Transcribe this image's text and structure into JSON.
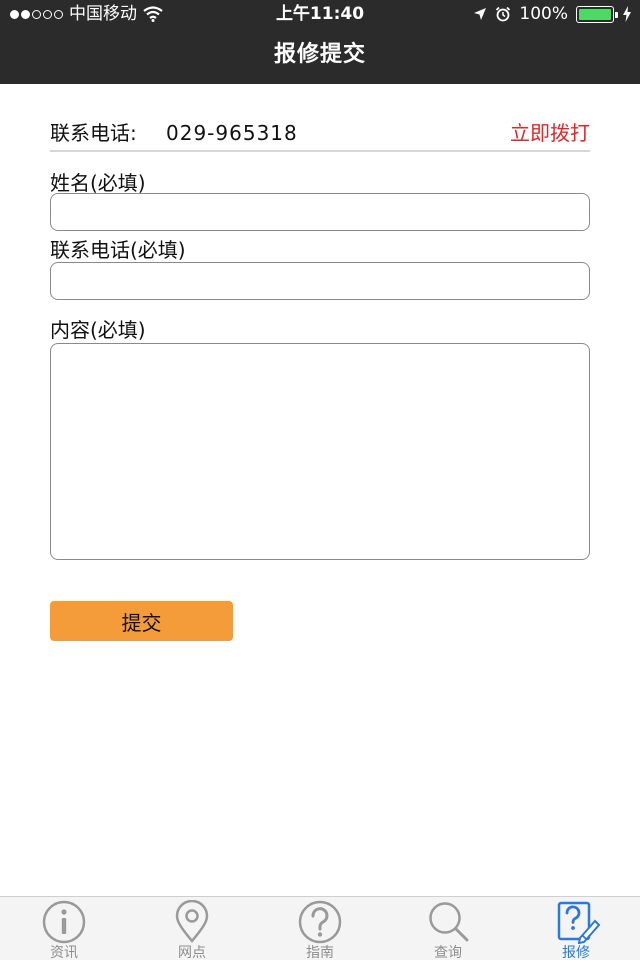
{
  "status_bar": {
    "carrier": "中国移动",
    "time": "上午11:40",
    "battery": "100%"
  },
  "nav": {
    "title": "报修提交"
  },
  "contact": {
    "label": "联系电话:",
    "number": "029-965318",
    "call_label": "立即拨打"
  },
  "form": {
    "name_label": "姓名(必填)",
    "name_value": "",
    "phone_label": "联系电话(必填)",
    "phone_value": "",
    "content_label": "内容(必填)",
    "content_value": "",
    "submit_label": "提交"
  },
  "tabs": [
    {
      "label": "资讯",
      "icon": "info-icon"
    },
    {
      "label": "网点",
      "icon": "location-pin-icon"
    },
    {
      "label": "指南",
      "icon": "question-icon"
    },
    {
      "label": "查询",
      "icon": "search-icon"
    },
    {
      "label": "报修",
      "icon": "repair-edit-icon",
      "active": true
    }
  ],
  "colors": {
    "header_bg": "#2b2b2b",
    "call_link": "#e0282b",
    "submit_bg": "#f49c39",
    "tab_active": "#2d79d6",
    "tab_inactive": "#8e8e8e",
    "battery": "#4cd964"
  }
}
